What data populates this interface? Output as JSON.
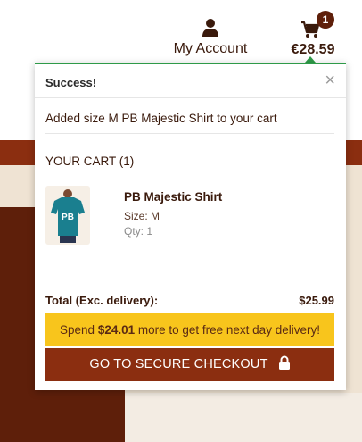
{
  "header": {
    "account_label": "My Account",
    "cart_count": "1",
    "cart_total": "€28.59"
  },
  "popup": {
    "title": "Success!",
    "close_glyph": "×",
    "message": "Added size M PB Majestic Shirt to your cart",
    "cart_heading": "YOUR CART (1)",
    "item": {
      "name": "PB Majestic Shirt",
      "size": "Size: M",
      "qty": "Qty: 1",
      "thumbnail_icon": "teal-tshirt-icon"
    },
    "totals_label": "Total (Exc. delivery):",
    "totals_value": "$25.99",
    "promo": {
      "prefix": "Spend ",
      "amount": "$24.01",
      "suffix": " more to get free next day delivery!"
    },
    "checkout_label": "GO TO SECURE CHECKOUT"
  },
  "colors": {
    "brand_dark": "#5e1f0a",
    "brand": "#8b2e10",
    "success": "#2e9a48",
    "promo": "#f8c51c",
    "cream": "#efe3d3"
  }
}
